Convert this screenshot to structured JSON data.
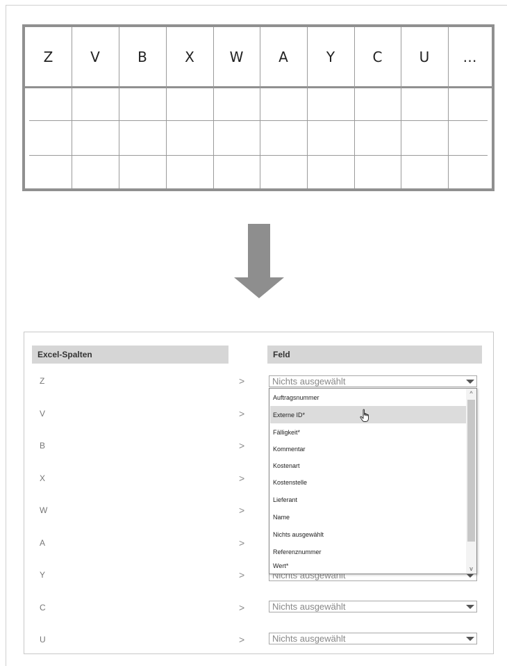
{
  "excel_columns": [
    "Z",
    "V",
    "B",
    "X",
    "W",
    "A",
    "Y",
    "C",
    "U",
    "…"
  ],
  "panel": {
    "left_header": "Excel-Spalten",
    "right_header": "Feld",
    "rows": [
      {
        "label": "Z",
        "value": "Nichts ausgewählt"
      },
      {
        "label": "V",
        "value": ""
      },
      {
        "label": "B",
        "value": ""
      },
      {
        "label": "X",
        "value": ""
      },
      {
        "label": "W",
        "value": ""
      },
      {
        "label": "A",
        "value": ""
      },
      {
        "label": "Y",
        "value": "Nichts ausgewählt"
      },
      {
        "label": "C",
        "value": "Nichts ausgewählt"
      },
      {
        "label": "U",
        "value": "Nichts ausgewählt"
      }
    ],
    "arrow_glyph": ">"
  },
  "dropdown": {
    "items": [
      "Auftragsnummer",
      "Externe ID*",
      "Fälligkeit*",
      "Kommentar",
      "Kostenart",
      "Kostenstelle",
      "Lieferant",
      "Name",
      "Nichts ausgewählt",
      "Referenznummer",
      "Wert*"
    ],
    "hovered_index": 1,
    "scroll_up": "^",
    "scroll_down": "v"
  },
  "icons": {
    "arrow": "down-arrow-icon",
    "cursor": "hand-pointer-icon",
    "caret": "chevron-down-icon"
  }
}
